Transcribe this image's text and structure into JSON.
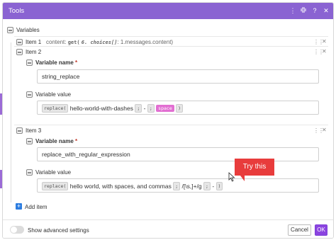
{
  "dialog": {
    "title": "Tools",
    "icons": [
      "more-vertical-icon",
      "collapse-icon",
      "help-icon",
      "close-icon"
    ]
  },
  "variables": {
    "label": "Variables",
    "item1": {
      "label": "Item 1",
      "content_prefix": "content:",
      "content_fn": "get(",
      "content_arg": "6. choices[]",
      "content_path": ": 1.messages.content",
      "content_close": ")"
    },
    "item2": {
      "label": "Item 2",
      "name_label": "Variable name",
      "name_value": "string_replace",
      "value_label": "Variable value",
      "value_fn": "replace(",
      "value_text": "hello-world-with-dashes",
      "value_sep1": ";",
      "value_dash": "-",
      "value_sep2": ";",
      "value_space": "space",
      "value_close": ")"
    },
    "item3": {
      "label": "Item 3",
      "name_label": "Variable name",
      "name_value": "replace_with_regular_expression",
      "value_label": "Variable value",
      "value_fn": "replace(",
      "value_text": "hello world, with spaces, and commas",
      "value_sep1": ";",
      "value_regex": "/[\\s,]+/g",
      "value_sep2": ";",
      "value_dash": "-",
      "value_close": ")"
    },
    "add_item": "Add item"
  },
  "tooltip": {
    "text": "Try this"
  },
  "footer": {
    "advanced_label": "Show advanced settings",
    "advanced_enabled": false,
    "cancel_label": "Cancel",
    "ok_label": "OK"
  },
  "colors": {
    "titlebar": "#8a63d2",
    "ok_button": "#8b44e0",
    "tooltip": "#e83c3c",
    "space_chip": "#e26fd2",
    "add_icon": "#2d7de0"
  }
}
